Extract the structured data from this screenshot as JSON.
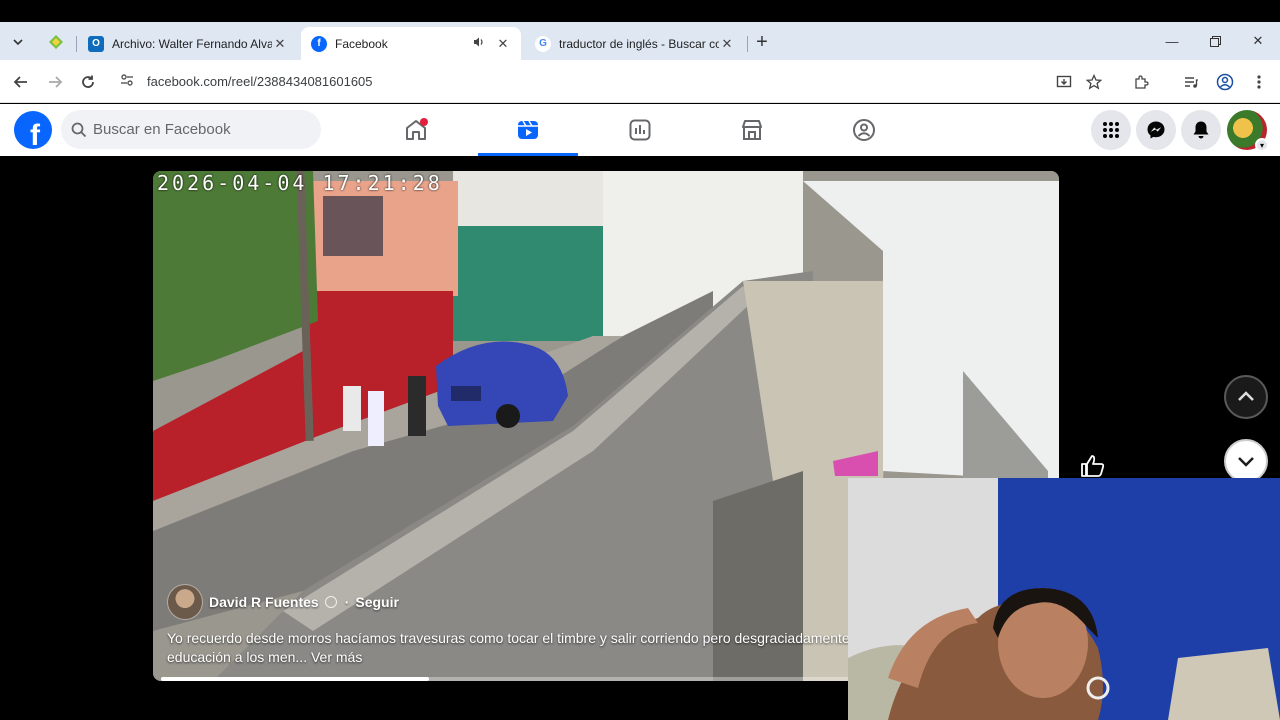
{
  "browser": {
    "tabs": [
      {
        "title": "Archivo: Walter Fernando Alvar",
        "favicon": "outlook-icon",
        "active": false
      },
      {
        "title": "Facebook",
        "favicon": "facebook-icon",
        "active": true,
        "audio": true
      },
      {
        "title": "traductor de inglés - Buscar co",
        "favicon": "google-icon",
        "active": false
      }
    ],
    "url": "facebook.com/reel/2388434081601605"
  },
  "facebook": {
    "search_placeholder": "Buscar en Facebook",
    "logo_letter": "f",
    "active_nav": "reels",
    "notification_dot": true
  },
  "reel": {
    "timestamp": "2026-04-04 17:21:28",
    "author": "David R Fuentes",
    "separator": "·",
    "follow_label": "Seguir",
    "caption": "Yo recuerdo desde morros hacíamos travesuras como tocar el timbre y salir corriendo pero desgraciadamente",
    "caption_line2": "educación a los men...",
    "more_label": "Ver más",
    "progress": 0.39
  },
  "colors": {
    "facebook_blue": "#0866ff",
    "tabstrip": "#dfe7f3",
    "search_bg": "#f0f2f5",
    "red_dot": "#e41e3f"
  }
}
